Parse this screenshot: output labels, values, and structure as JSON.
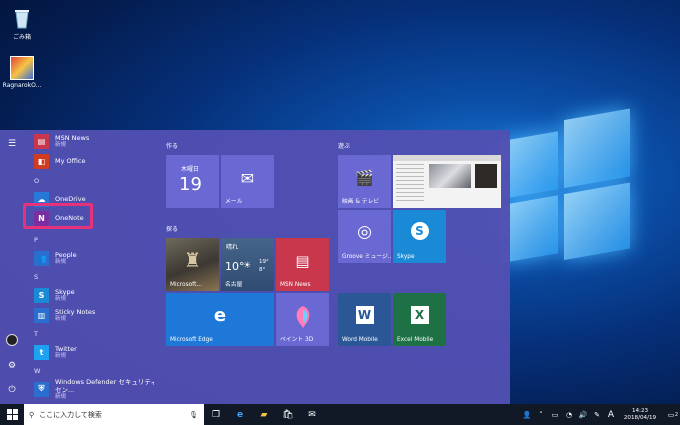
{
  "desktop": {
    "icons": [
      {
        "label": "ごみ箱",
        "icon": "recycle-bin-icon"
      },
      {
        "label": "RagnarokO...",
        "icon": "game-shortcut-icon"
      }
    ]
  },
  "start_menu": {
    "rail_icons": [
      "hamburger-menu-icon",
      "user-avatar-icon",
      "settings-icon",
      "power-icon"
    ],
    "app_list": [
      {
        "name": "MSN News",
        "sub": "新規",
        "color": "#c8374b"
      },
      {
        "name": "My Office",
        "sub": "",
        "color": "#d13b22"
      },
      {
        "letter": "O"
      },
      {
        "name": "OneDrive",
        "sub": "",
        "color": "#2878d7"
      },
      {
        "name": "OneNote",
        "sub": "",
        "color": "#7a2ea1"
      },
      {
        "letter": "P"
      },
      {
        "name": "People",
        "sub": "新規",
        "color": "#2a6fd0"
      },
      {
        "letter": "S"
      },
      {
        "name": "Skype",
        "sub": "新規",
        "color": "#1b8ad6"
      },
      {
        "name": "Sticky Notes",
        "sub": "新規",
        "color": "#2a6fd0"
      },
      {
        "letter": "T"
      },
      {
        "name": "Twitter",
        "sub": "新規",
        "color": "#1da1f2"
      },
      {
        "letter": "W"
      },
      {
        "name": "Windows Defender セキュリティ セン...",
        "sub": "新規",
        "color": "#2a6fd0"
      }
    ],
    "groups": {
      "create": "作る",
      "explore": "探る",
      "play": "遊ぶ"
    },
    "tiles": {
      "calendar": {
        "weekday": "木曜日",
        "day": "19"
      },
      "mail": {
        "label": "メール"
      },
      "store": {
        "label": "Microsoft..."
      },
      "weather": {
        "condition": "晴れ",
        "temp": "10°",
        "high": "19°",
        "low": "8°",
        "city": "名古屋"
      },
      "msn_news": {
        "label": "MSN News"
      },
      "edge": {
        "label": "Microsoft Edge"
      },
      "paint3d": {
        "label": "ペイント 3D"
      },
      "movies": {
        "label": "映画 & テレビ"
      },
      "groove": {
        "label": "Groove ミュージ..."
      },
      "skype": {
        "label": "Skype"
      },
      "word": {
        "label": "Word Mobile"
      },
      "excel": {
        "label": "Excel Mobile"
      }
    }
  },
  "taskbar": {
    "search_placeholder": "ここに入力して検索",
    "ime": "A",
    "time": "14:23",
    "date": "2018/04/19",
    "notifications": "2"
  }
}
